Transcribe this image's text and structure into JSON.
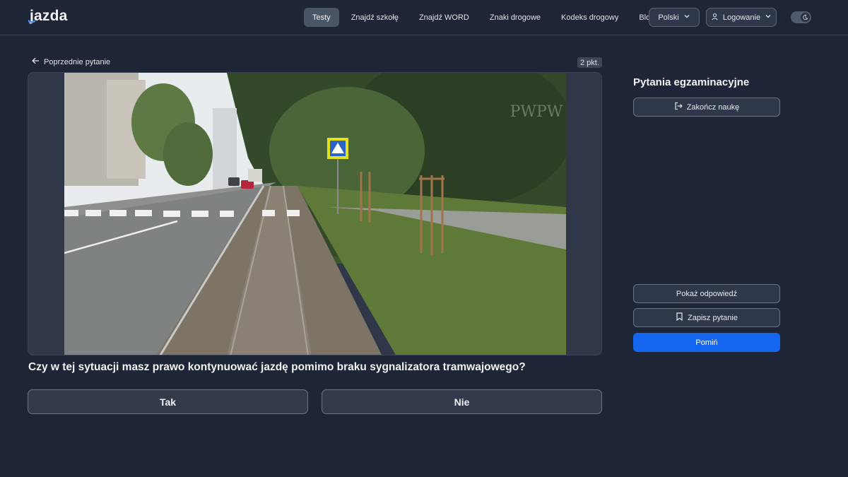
{
  "header": {
    "logo": "jazda",
    "nav": [
      {
        "label": "Testy",
        "active": true
      },
      {
        "label": "Znajdź szkołę",
        "active": false
      },
      {
        "label": "Znajdź WORD",
        "active": false
      },
      {
        "label": "Znaki drogowe",
        "active": false
      },
      {
        "label": "Kodeks drogowy",
        "active": false
      },
      {
        "label": "Blog",
        "active": false
      }
    ],
    "language": "Polski",
    "login": "Logowanie",
    "theme_toggle": "dark"
  },
  "main": {
    "prev_label": "Poprzednie pytanie",
    "points": "2 pkt.",
    "watermark": "PWPW",
    "question": "Czy w tej sytuacji masz prawo kontynuować jazdę pomimo braku sygnalizatora tramwajowego?",
    "answers": [
      "Tak",
      "Nie"
    ]
  },
  "sidebar": {
    "title": "Pytania egzaminacyjne",
    "finish_label": "Zakończ naukę",
    "show_answer_label": "Pokaż odpowiedź",
    "save_label": "Zapisz pytanie",
    "skip_label": "Pomiń"
  },
  "colors": {
    "background": "#1e2537",
    "primary": "#1466f1",
    "surface": "#323a4c"
  }
}
